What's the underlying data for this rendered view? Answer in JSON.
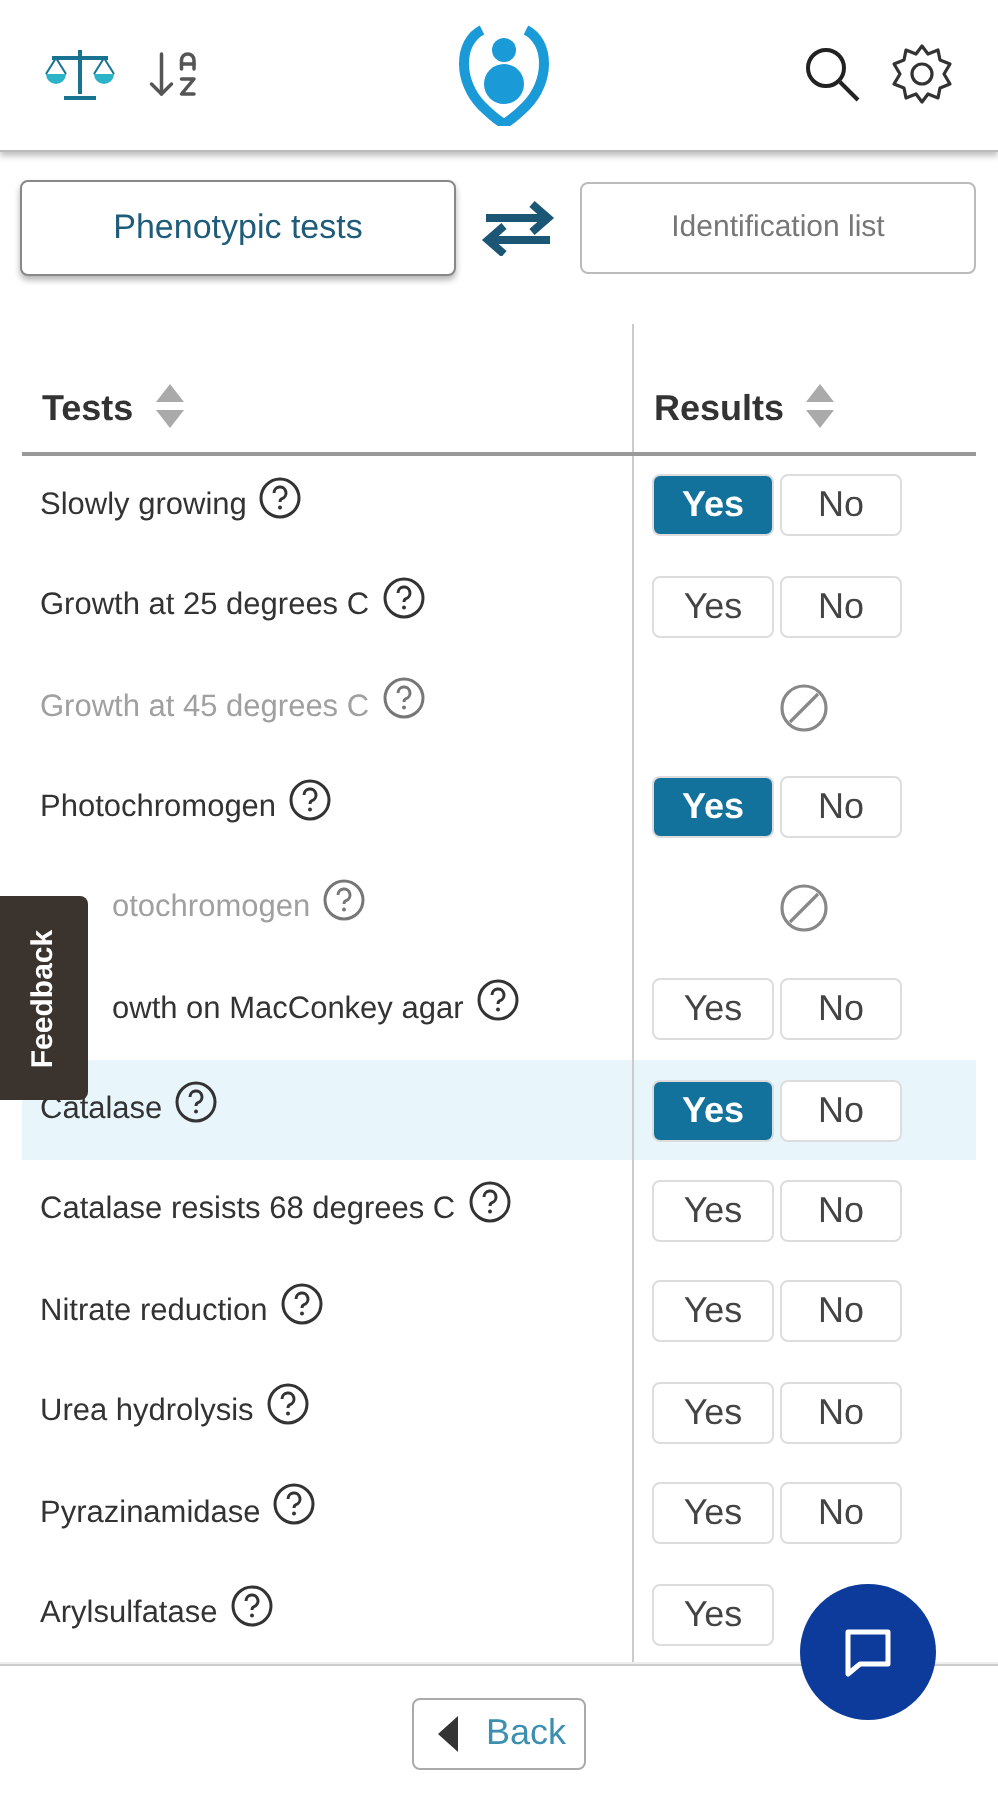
{
  "view_tabs": [
    {
      "label": "Phenotypic tests",
      "selected": true
    },
    {
      "label": "Identification list",
      "selected": false
    }
  ],
  "table": {
    "columns": [
      "Tests",
      "Results"
    ],
    "rows": [
      {
        "test": "Slowly growing",
        "kind": "toggle",
        "highlighted": false,
        "options": [
          {
            "label": "Yes",
            "selected": true
          },
          {
            "label": "No",
            "selected": false
          }
        ]
      },
      {
        "test": "Growth at 25 degrees C",
        "kind": "toggle",
        "highlighted": false,
        "options": [
          {
            "label": "Yes",
            "selected": false
          },
          {
            "label": "No",
            "selected": false
          }
        ]
      },
      {
        "test": "Growth at 45 degrees C",
        "kind": "unavailable",
        "highlighted": false
      },
      {
        "test": "Photochromogen",
        "kind": "toggle",
        "highlighted": false,
        "options": [
          {
            "label": "Yes",
            "selected": true
          },
          {
            "label": "No",
            "selected": false
          }
        ]
      },
      {
        "test": "otochromogen",
        "kind": "unavailable",
        "highlighted": false
      },
      {
        "test": "owth on MacConkey agar",
        "kind": "toggle",
        "highlighted": false,
        "options": [
          {
            "label": "Yes",
            "selected": false
          },
          {
            "label": "No",
            "selected": false
          }
        ]
      },
      {
        "test": "Catalase",
        "kind": "toggle",
        "highlighted": true,
        "options": [
          {
            "label": "Yes",
            "selected": true
          },
          {
            "label": "No",
            "selected": false
          }
        ]
      },
      {
        "test": "Catalase resists 68 degrees C",
        "kind": "toggle",
        "highlighted": false,
        "options": [
          {
            "label": "Yes",
            "selected": false
          },
          {
            "label": "No",
            "selected": false
          }
        ]
      },
      {
        "test": "Nitrate reduction",
        "kind": "toggle",
        "highlighted": false,
        "options": [
          {
            "label": "Yes",
            "selected": false
          },
          {
            "label": "No",
            "selected": false
          }
        ]
      },
      {
        "test": "Urea hydrolysis",
        "kind": "toggle",
        "highlighted": false,
        "options": [
          {
            "label": "Yes",
            "selected": false
          },
          {
            "label": "No",
            "selected": false
          }
        ]
      },
      {
        "test": "Pyrazinamidase",
        "kind": "toggle",
        "highlighted": false,
        "options": [
          {
            "label": "Yes",
            "selected": false
          },
          {
            "label": "No",
            "selected": false
          }
        ]
      },
      {
        "test": "Arylsulfatase",
        "kind": "toggle",
        "highlighted": false,
        "options": [
          {
            "label": "Yes",
            "selected": false
          }
        ]
      }
    ]
  },
  "feedback_tab": {
    "label": "Feedback"
  },
  "back_button": {
    "label": "Back"
  }
}
